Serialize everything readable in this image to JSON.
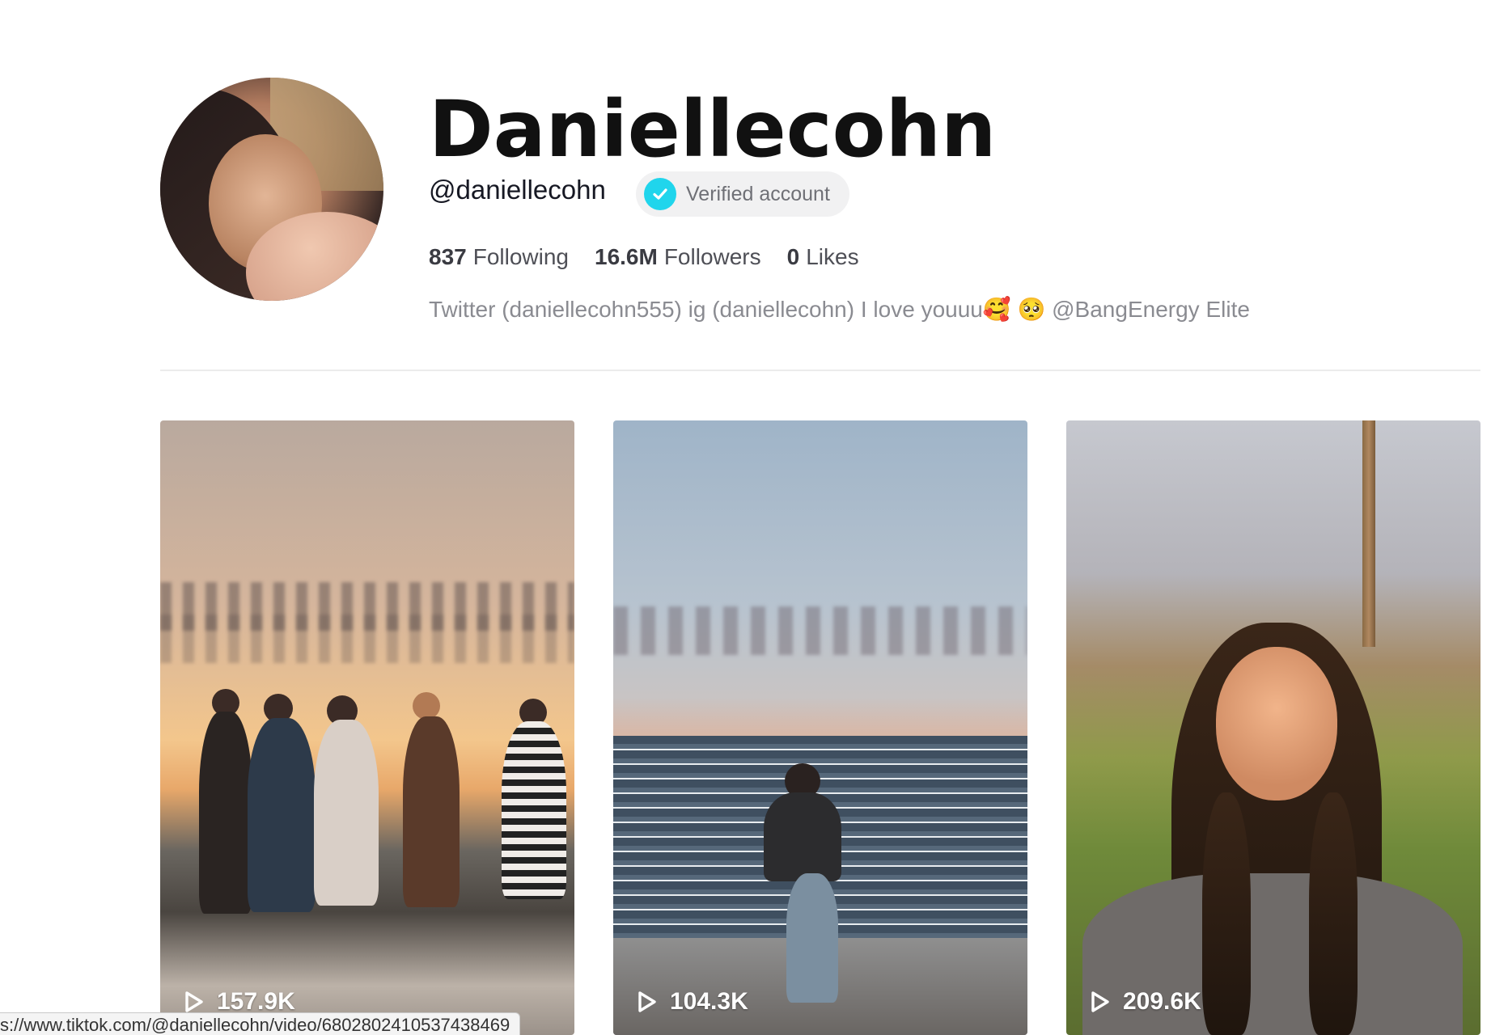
{
  "profile": {
    "display_name": "Daniellecohn",
    "handle": "@daniellecohn",
    "verified_label": "Verified account",
    "stats": [
      {
        "value": "837",
        "label": "Following"
      },
      {
        "value": "16.6M",
        "label": "Followers"
      },
      {
        "value": "0",
        "label": "Likes"
      }
    ],
    "bio": "Twitter (daniellecohn555) ig (daniellecohn) I love youuu🥰 🥺  @BangEnergy Elite"
  },
  "videos": [
    {
      "views": "157.9K"
    },
    {
      "views": "104.3K"
    },
    {
      "views": "209.6K"
    }
  ],
  "status_bar": {
    "url": "s://www.tiktok.com/@daniellecohn/video/6802802410537438469"
  },
  "colors": {
    "verified_badge": "#20d5ec",
    "text_primary": "#161823",
    "text_muted": "#8a8b91"
  }
}
